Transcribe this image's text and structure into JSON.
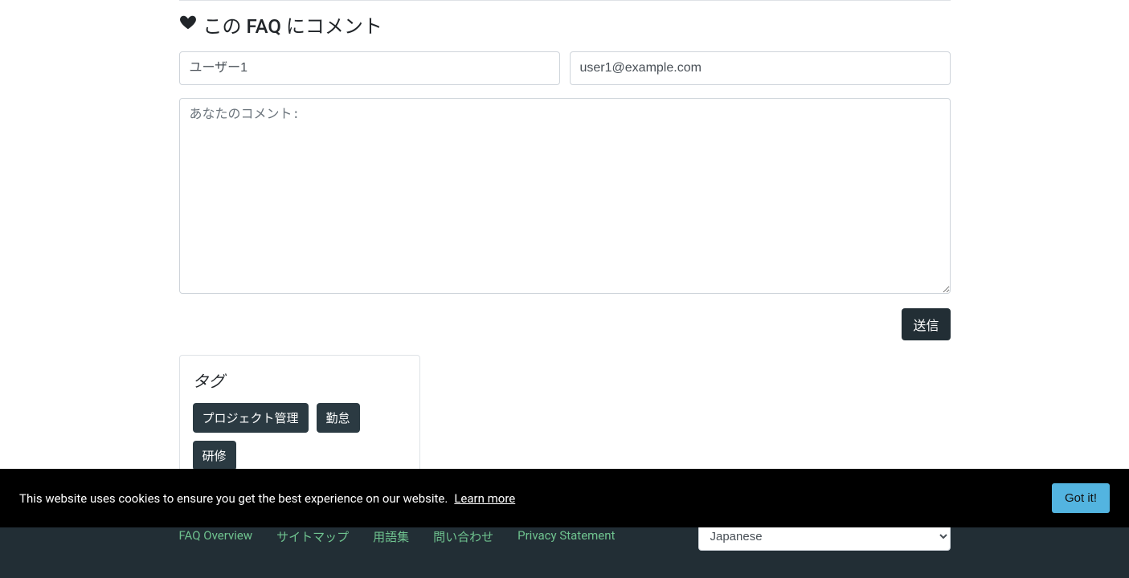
{
  "comment": {
    "heading": "この FAQ にコメント",
    "name_value": "ユーザー1",
    "email_value": "user1@example.com",
    "body_placeholder": "あなたのコメント:",
    "submit_label": "送信"
  },
  "tags": {
    "title": "タグ",
    "items": [
      "プロジェクト管理",
      "勤怠",
      "研修"
    ]
  },
  "footer": {
    "links": [
      "FAQ Overview",
      "サイトマップ",
      "用語集",
      "問い合わせ",
      "Privacy Statement"
    ],
    "language_selected": "Japanese"
  },
  "cookie": {
    "text": "This website uses cookies to ensure you get the best experience on our website.",
    "learn_more": "Learn more",
    "dismiss": "Got it!"
  }
}
